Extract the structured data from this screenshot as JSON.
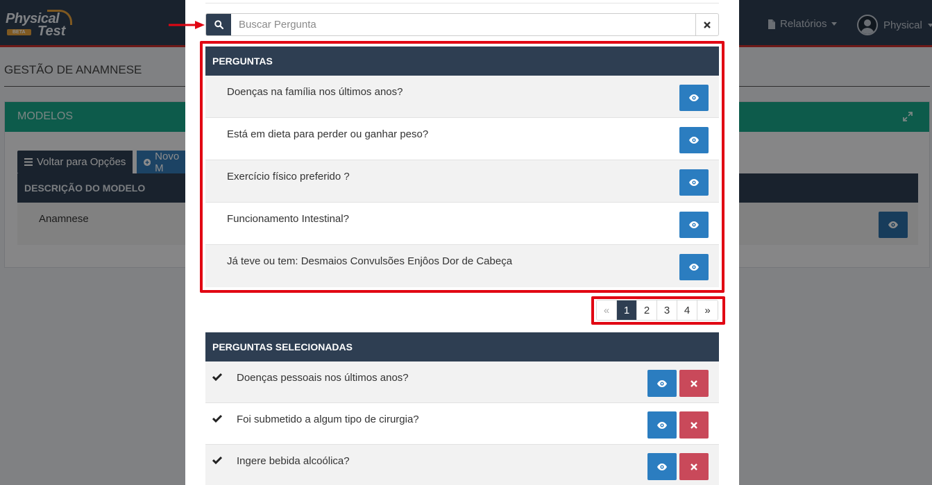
{
  "brand": {
    "line1": "Physical",
    "line2": "Test",
    "badge": "BETA"
  },
  "navbar": {
    "reports_label": "Relatórios",
    "user_label": "Physical"
  },
  "page": {
    "title": "GESTÃO DE ANAMNESE"
  },
  "card": {
    "title": "MODELOS",
    "back_button": "Voltar para Opções",
    "new_button": "Novo M",
    "table_header": "DESCRIÇÃO DO MODELO",
    "rows": [
      {
        "label": "Anamnese"
      }
    ]
  },
  "modal": {
    "search": {
      "placeholder": "Buscar Pergunta",
      "value": ""
    },
    "questions": {
      "header": "PERGUNTAS",
      "items": [
        {
          "label": "Doenças na família nos últimos anos?"
        },
        {
          "label": "Está em dieta para perder ou ganhar peso?"
        },
        {
          "label": "Exercício físico preferido ?"
        },
        {
          "label": "Funcionamento Intestinal?"
        },
        {
          "label": "Já teve ou tem: Desmaios Convulsões Enjôos Dor de Cabeça"
        }
      ]
    },
    "pagination": {
      "prev": "«",
      "pages": [
        "1",
        "2",
        "3",
        "4"
      ],
      "next": "»",
      "active_page": "1"
    },
    "selected": {
      "header": "PERGUNTAS SELECIONADAS",
      "items": [
        {
          "label": "Doenças pessoais nos últimos anos?"
        },
        {
          "label": "Foi submetido a algum tipo de cirurgia?"
        },
        {
          "label": "Ingere bebida alcoólica?"
        }
      ]
    }
  },
  "colors": {
    "navbar": "#2e3e52",
    "header_dark": "#2e3e52",
    "card_header": "#18a689",
    "eye_button": "#2b7dc0",
    "delete_button": "#c9495a",
    "highlight": "#e10613"
  },
  "icons": {
    "search": "search-icon",
    "clear": "times-icon",
    "view": "eye-icon",
    "remove": "times-icon",
    "selected": "check-icon",
    "reports": "file-icon",
    "expand": "expand-icon",
    "menu": "bars-icon",
    "add": "plus-circle-icon"
  }
}
